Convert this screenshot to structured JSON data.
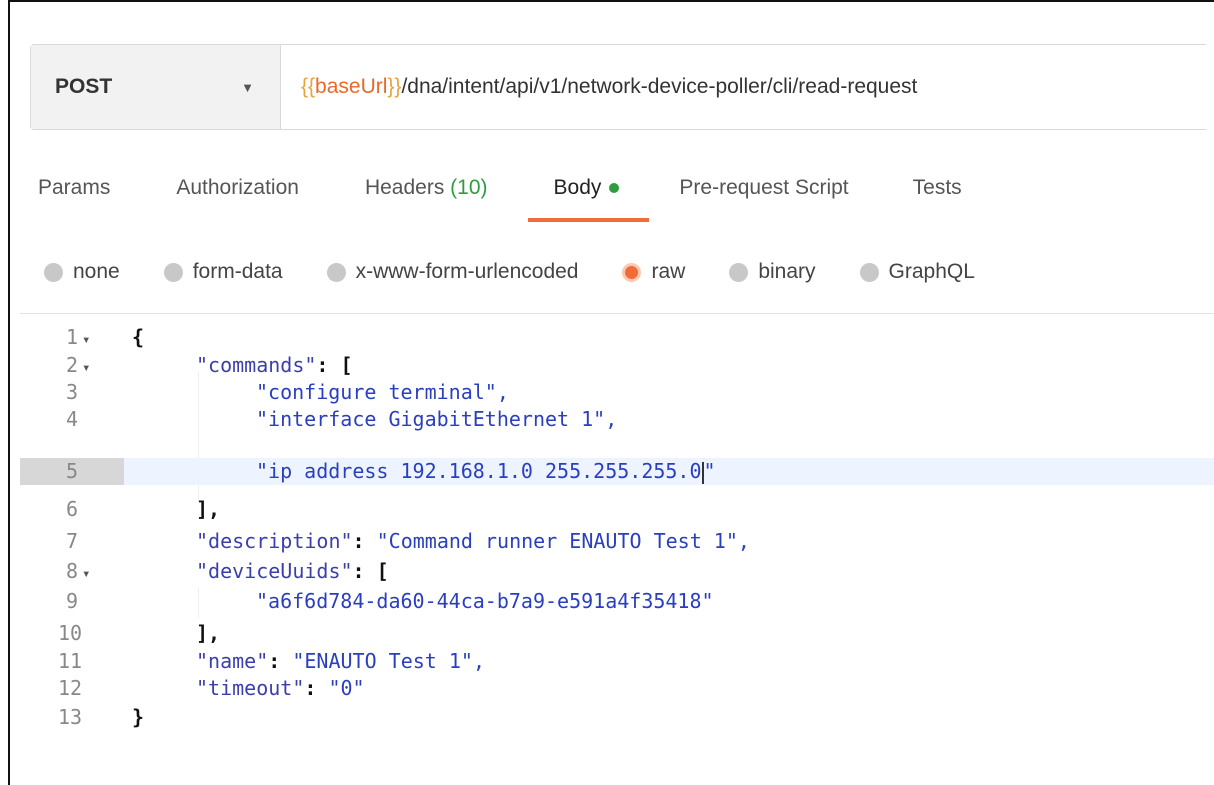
{
  "request": {
    "method": "POST",
    "url_var_open": "{{",
    "url_var_name": "baseUrl",
    "url_var_close": "}}",
    "url_path": "/dna/intent/api/v1/network-device-poller/cli/read-request"
  },
  "tabs": {
    "params": "Params",
    "authorization": "Authorization",
    "headers": "Headers",
    "headers_count": "(10)",
    "body": "Body",
    "pre_request": "Pre-request Script",
    "tests": "Tests"
  },
  "body_types": {
    "none": "none",
    "form_data": "form-data",
    "urlencoded": "x-www-form-urlencoded",
    "raw": "raw",
    "binary": "binary",
    "graphql": "GraphQL",
    "selected": "raw"
  },
  "editor": {
    "line_numbers": [
      "1",
      "2",
      "3",
      "4",
      "5",
      "6",
      "7",
      "8",
      "9",
      "10",
      "11",
      "12",
      "13"
    ],
    "current_line": "5",
    "l1": "{",
    "l2_key": "\"commands\"",
    "l2_rest": ": [",
    "l3": "\"configure terminal\",",
    "l4": "\"interface GigabitEthernet 1\",",
    "l5": "\"ip address 192.168.1.0 255.255.255.0",
    "l5_end": "\"",
    "l6": "],",
    "l7_key": "\"description\"",
    "l7_value": "\"Command runner ENAUTO Test 1\",",
    "l8_key": "\"deviceUuids\"",
    "l8_rest": ": [",
    "l9": "\"a6f6d784-da60-44ca-b7a9-e591a4f35418\"",
    "l10": "],",
    "l11_key": "\"name\"",
    "l11_value": "\"ENAUTO Test 1\",",
    "l12_key": "\"timeout\"",
    "l12_value": "\"0\"",
    "l13": "}"
  },
  "colors": {
    "accent": "#f26b3a",
    "green": "#2e9d3f",
    "variable": "#e8692b"
  }
}
